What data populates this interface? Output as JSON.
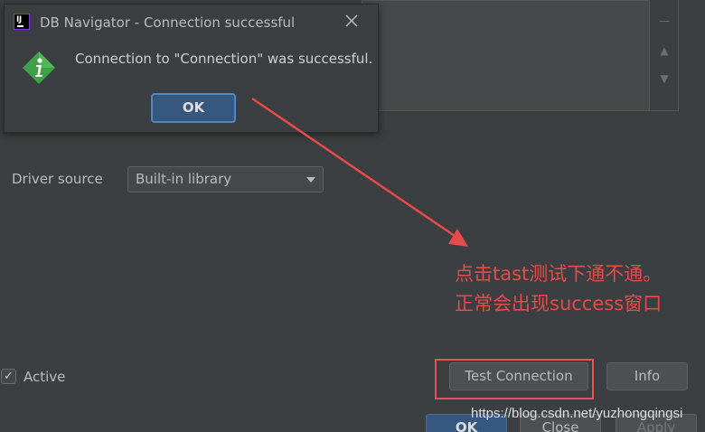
{
  "dialog": {
    "title": "DB Navigator - Connection successful",
    "message": "Connection to \"Connection\" was successful.",
    "ok_label": "OK"
  },
  "form": {
    "driver_source_label": "Driver source",
    "driver_source_value": "Built-in library",
    "active_label": "Active",
    "active_checked": true
  },
  "buttons": {
    "test_connection": "Test Connection",
    "info": "Info",
    "ok": "OK",
    "close": "Close",
    "apply": "Apply"
  },
  "annotation": {
    "line1": "点击tast测试下通不通。",
    "line2": "正常会出现success窗口",
    "color": "#e84a4a"
  },
  "watermark": "https://blog.csdn.net/yuzhongqingsi",
  "colors": {
    "background": "#3c3f41",
    "accent": "#365880",
    "annotation": "#e84a4a",
    "info_icon": "#3ea04a"
  }
}
